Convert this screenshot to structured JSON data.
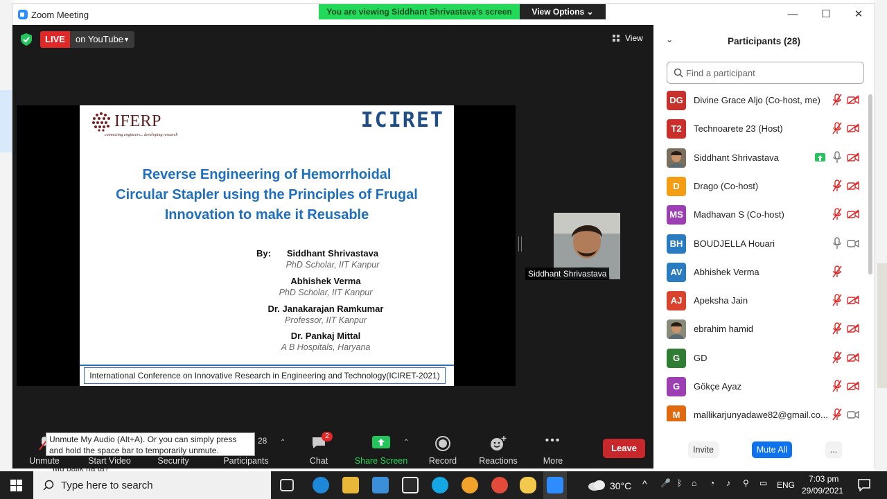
{
  "window": {
    "title": "Zoom Meeting",
    "minimize": "—",
    "maximize": "☐",
    "close": "✕"
  },
  "banner": {
    "viewing_text": "You are viewing Siddhant Shrivastava's screen",
    "view_options": "View Options ⌄"
  },
  "meeting": {
    "live_label": "LIVE",
    "live_target": "on YouTube",
    "view_label": "View"
  },
  "slide": {
    "logo_name": "IFERP",
    "logo_tagline": "connecting engineers... developing research",
    "conference_logo": "ICIRET",
    "title_lines": [
      "Reverse Engineering of Hemorrhoidal",
      "Circular Stapler using the Principles of Frugal",
      "Innovation to make it Reusable"
    ],
    "by_label": "By:",
    "authors": [
      {
        "name": "Siddhant Shrivastava",
        "affiliation": "PhD Scholar, IIT Kanpur"
      },
      {
        "name": "Abhishek Verma",
        "affiliation": "PhD Scholar, IIT Kanpur"
      },
      {
        "name": "Dr. Janakarajan Ramkumar",
        "affiliation": "Professor, IIT Kanpur"
      },
      {
        "name": "Dr. Pankaj Mittal",
        "affiliation": "A B Hospitals, Haryana"
      }
    ],
    "footer": "International Conference on Innovative Research in Engineering and Technology(ICIRET-2021)"
  },
  "thumbnail": {
    "name": "Siddhant Shrivastava"
  },
  "toolbar": {
    "tooltip": "Unmute My Audio (Alt+A). Or you can simply press and hold the space bar to temporarily unmute.",
    "unmute": "Unmute",
    "start_video": "Start Video",
    "security": "Security",
    "participants": "Participants",
    "participants_count": "28",
    "chat": "Chat",
    "chat_badge": "2",
    "share_screen": "Share Screen",
    "record": "Record",
    "reactions": "Reactions",
    "more": "More",
    "leave": "Leave"
  },
  "panel": {
    "title": "Participants (28)",
    "search_placeholder": "Find a participant",
    "invite": "Invite",
    "mute_all": "Mute All",
    "more": "...",
    "participants": [
      {
        "initials": "DG",
        "name": "Divine Grace Aljo (Co-host, me)",
        "color": "#c9302c",
        "mic": "muted",
        "cam": "off"
      },
      {
        "initials": "T2",
        "name": "Technoarete 23 (Host)",
        "color": "#c9302c",
        "mic": "muted",
        "cam": "off"
      },
      {
        "initials": "",
        "name": "Siddhant Shrivastava",
        "color": "#7a6f5f",
        "mic": "on",
        "cam": "off",
        "sharing": true
      },
      {
        "initials": "D",
        "name": "Drago (Co-host)",
        "color": "#f29d13",
        "mic": "muted",
        "cam": "off"
      },
      {
        "initials": "MS",
        "name": "Madhavan S (Co-host)",
        "color": "#9b3fb3",
        "mic": "muted",
        "cam": "off"
      },
      {
        "initials": "BH",
        "name": "BOUDJELLA Houari",
        "color": "#2b7bc0",
        "mic": "on",
        "cam": "on"
      },
      {
        "initials": "AV",
        "name": "Abhishek Verma",
        "color": "#2b7bc0",
        "mic": "muted",
        "cam": "none"
      },
      {
        "initials": "AJ",
        "name": "Apeksha Jain",
        "color": "#d9432e",
        "mic": "muted",
        "cam": "off"
      },
      {
        "initials": "",
        "name": "ebrahim hamid",
        "color": "#8a8a7a",
        "mic": "muted",
        "cam": "off"
      },
      {
        "initials": "G",
        "name": "GD",
        "color": "#2e7d32",
        "mic": "muted",
        "cam": "off"
      },
      {
        "initials": "G",
        "name": "Gökçe Ayaz",
        "color": "#9b3fb3",
        "mic": "muted",
        "cam": "off"
      },
      {
        "initials": "M",
        "name": "mallikarjunyadawe82@gmail.co...",
        "color": "#e06a10",
        "mic": "muted",
        "cam": "on"
      }
    ]
  },
  "taskbar": {
    "search_placeholder": "Type here to search",
    "weather": "30°C",
    "language": "ENG",
    "time": "7:03 pm",
    "date": "29/09/2021"
  },
  "peek": {
    "text": "Mu balik na ta?"
  }
}
